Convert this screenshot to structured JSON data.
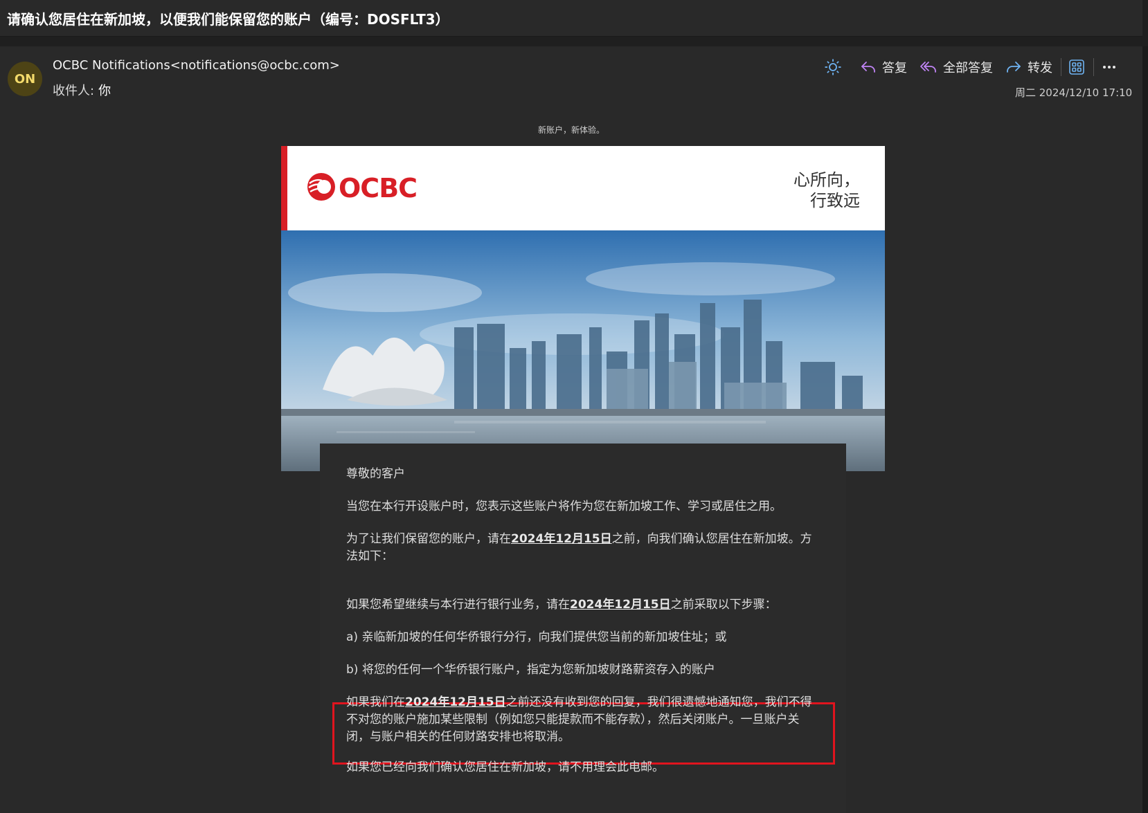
{
  "subject": "请确认您居住在新加坡，以便我们能保留您的账户（编号：DOSFLT3）",
  "sender": {
    "initials": "ON",
    "display": "OCBC Notifications<notifications@ocbc.com>"
  },
  "recipient": {
    "label": "收件人:",
    "name": "你"
  },
  "toolbar": {
    "reply": "答复",
    "reply_all": "全部答复",
    "forward": "转发"
  },
  "timestamp": "周二 2024/12/10 17:10",
  "email": {
    "preheader": "新账户，新体验。",
    "logo_text": "OCBC",
    "tagline_line1": "心所向，",
    "tagline_line2": "行致远",
    "greeting": "尊敬的客户",
    "para1": "当您在本行开设账户时，您表示这些账户将作为您在新加坡工作、学习或居住之用。",
    "para2_pre": "为了让我们保留您的账户，请在",
    "deadline": "2024年12月15日",
    "para2_post": "之前，向我们确认您居住在新加坡。方法如下：",
    "para3_pre": "如果您希望继续与本行进行银行业务，请在",
    "para3_post": "之前采取以下步骤：",
    "step_a": "a) 亲临新加坡的任何华侨银行分行，向我们提供您当前的新加坡住址；或",
    "step_b": "b) 将您的任何一个华侨银行账户，指定为您新加坡财路薪资存入的账户",
    "para4_pre": "如果我们在",
    "para4_post": "之前还没有收到您的回复，我们很遗憾地通知您，我们不得不对您的账户施加某些限制（例如您只能提款而不能存款），然后关闭账户。一旦账户关闭，与账户相关的任何财路安排也将取消。",
    "para5": "如果您已经向我们确认您居住在新加坡，请不用理会此电邮。"
  },
  "colors": {
    "brand_red": "#d81f26",
    "highlight_border": "#e0141e",
    "avatar_bg": "#4d4315",
    "avatar_fg": "#f3da6b"
  },
  "icons": [
    "sun-icon",
    "reply-icon",
    "reply-all-icon",
    "forward-icon",
    "apps-icon",
    "more-icon"
  ]
}
